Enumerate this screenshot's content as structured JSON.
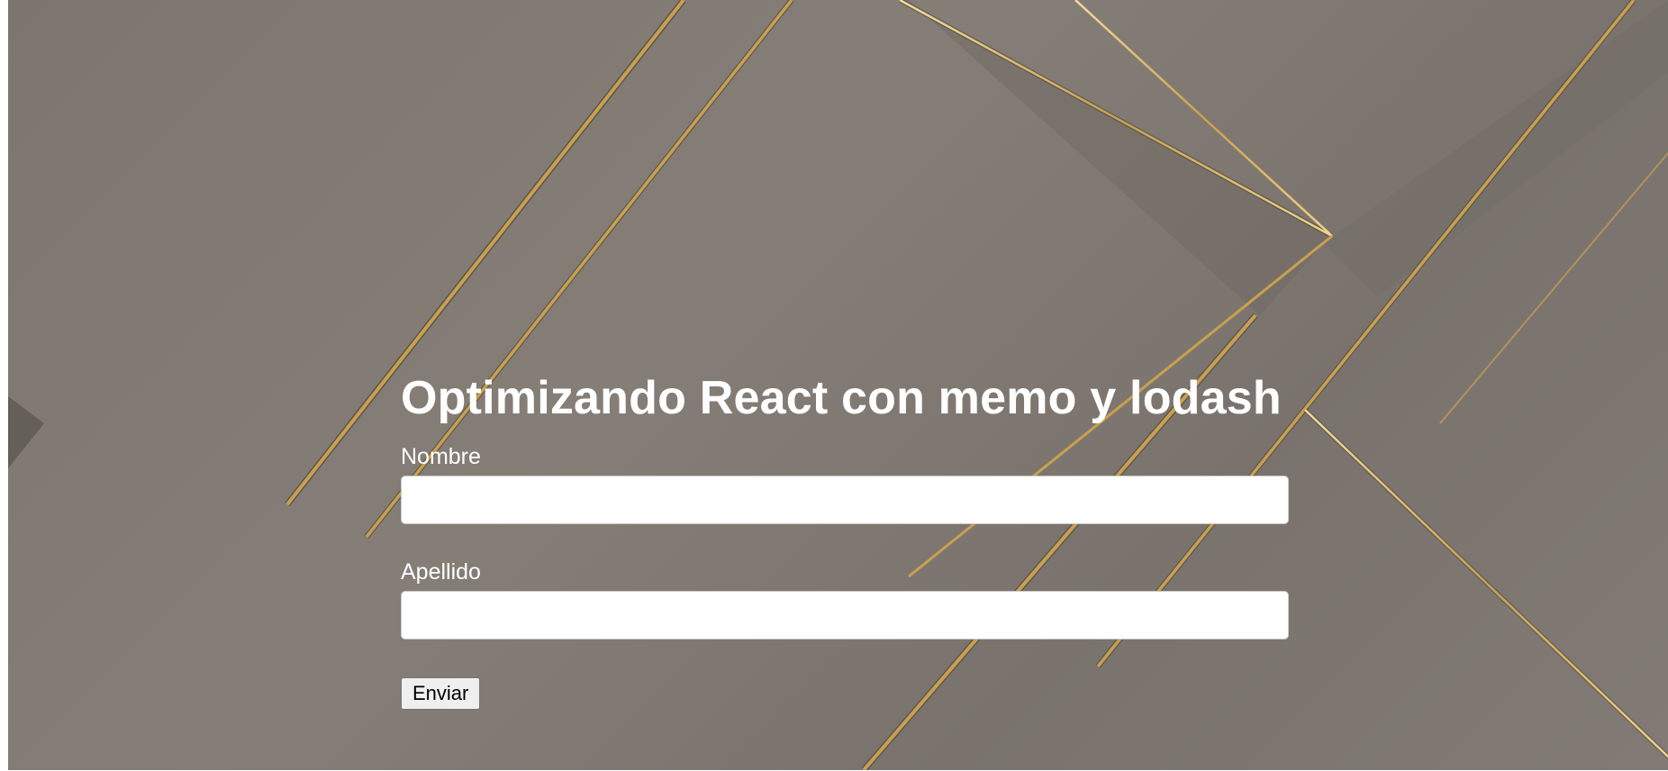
{
  "page": {
    "title": "Optimizando React con memo y lodash"
  },
  "form": {
    "first_name_label": "Nombre",
    "first_name_value": "",
    "last_name_label": "Apellido",
    "last_name_value": "",
    "submit_label": "Enviar"
  },
  "theme": {
    "background": "#7f7872",
    "accent_gold": "#d8b25a",
    "text": "#ffffff"
  }
}
